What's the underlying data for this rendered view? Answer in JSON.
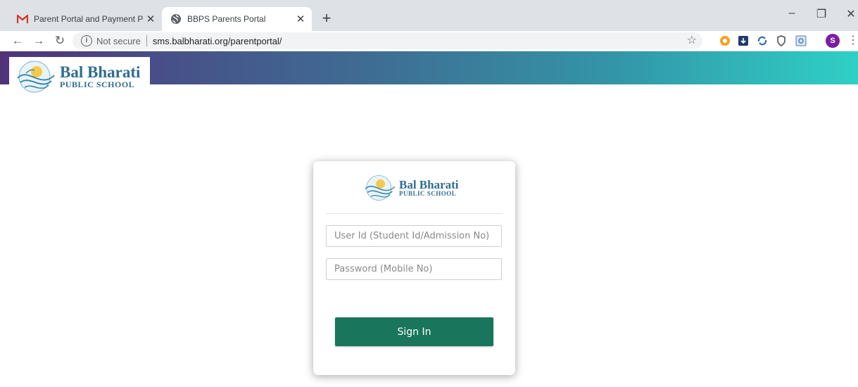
{
  "browser": {
    "tabs": [
      {
        "title": "Parent Portal and Payment Portal",
        "favicon": "gmail-icon",
        "active": false
      },
      {
        "title": "BBPS Parents Portal",
        "favicon": "globe-icon",
        "active": true
      }
    ],
    "new_tab_label": "+",
    "url_security": "Not secure",
    "url": "sms.balbharati.org/parentportal/",
    "profile_initial": "S",
    "extensions": [
      "chrome-extension-orange-icon",
      "download-icon",
      "sync-icon",
      "shield-icon",
      "screenshot-icon"
    ]
  },
  "header": {
    "school_name": "Bal Bharati",
    "school_subtitle": "PUBLIC SCHOOL"
  },
  "login": {
    "logo_name": "Bal Bharati",
    "logo_subtitle": "PUBLIC SCHOOL",
    "user_id_placeholder": "User Id (Student Id/Admission No)",
    "user_id_value": "",
    "password_placeholder": "Password (Mobile No)",
    "password_value": "",
    "sign_in_label": "Sign In"
  },
  "colors": {
    "header_gradient_start": "#50327a",
    "header_gradient_end": "#2fd0c6",
    "sign_in_button": "#19765c",
    "logo_text": "#2f6e8f"
  }
}
